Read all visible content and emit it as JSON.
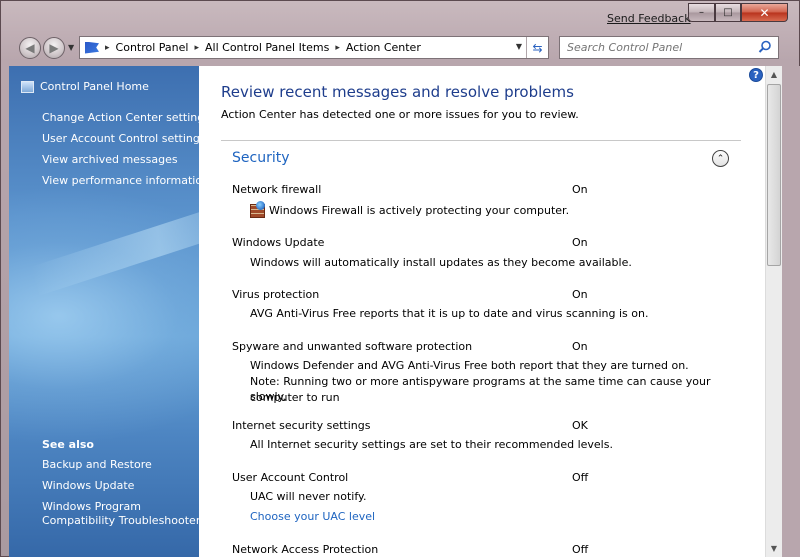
{
  "titlebar": {
    "send_feedback": "Send Feedback",
    "minimize": "–",
    "maximize": "□",
    "close": "✕"
  },
  "navigation": {
    "back_glyph": "◀",
    "forward_glyph": "▶",
    "breadcrumbs": [
      "Control Panel",
      "All Control Panel Items",
      "Action Center"
    ],
    "search_placeholder": "Search Control Panel"
  },
  "sidebar": {
    "home": "Control Panel Home",
    "links": [
      "Change Action Center settings",
      "User Account Control settings",
      "View archived messages",
      "View performance information"
    ],
    "see_also_heading": "See also",
    "see_also_links": [
      "Backup and Restore",
      "Windows Update",
      "Windows Program",
      "Compatibility Troubleshooter"
    ]
  },
  "main": {
    "help": "?",
    "title": "Review recent messages and resolve problems",
    "subtitle": "Action Center has detected one or more issues for you to review.",
    "section": {
      "title": "Security",
      "collapse_glyph": "⌃",
      "items": [
        {
          "name": "Network firewall",
          "status": "On",
          "description": "Windows Firewall is actively protecting your computer."
        },
        {
          "name": "Windows Update",
          "status": "On",
          "description": "Windows will automatically install updates as they become available."
        },
        {
          "name": "Virus protection",
          "status": "On",
          "description": "AVG Anti-Virus Free reports that it is up to date and virus scanning is on."
        },
        {
          "name": "Spyware and unwanted software protection",
          "status": "On",
          "description_lines": [
            "Windows Defender and AVG Anti-Virus Free both report that they are turned on.",
            "Note: Running two or more antispyware programs at the same time can cause your computer to run",
            "slowly."
          ]
        },
        {
          "name": "Internet security settings",
          "status": "OK",
          "description": "All Internet security settings are set to their recommended levels."
        },
        {
          "name": "User Account Control",
          "status": "Off",
          "description": "UAC will never notify.",
          "link": "Choose your UAC level"
        }
      ],
      "partial_next_row": {
        "name": "Network Access Protection",
        "status": "Off"
      }
    }
  },
  "colors": {
    "title_blue": "#1e3d8c",
    "section_blue": "#1e64c0",
    "sidebar_blue": "#4d85c2"
  }
}
